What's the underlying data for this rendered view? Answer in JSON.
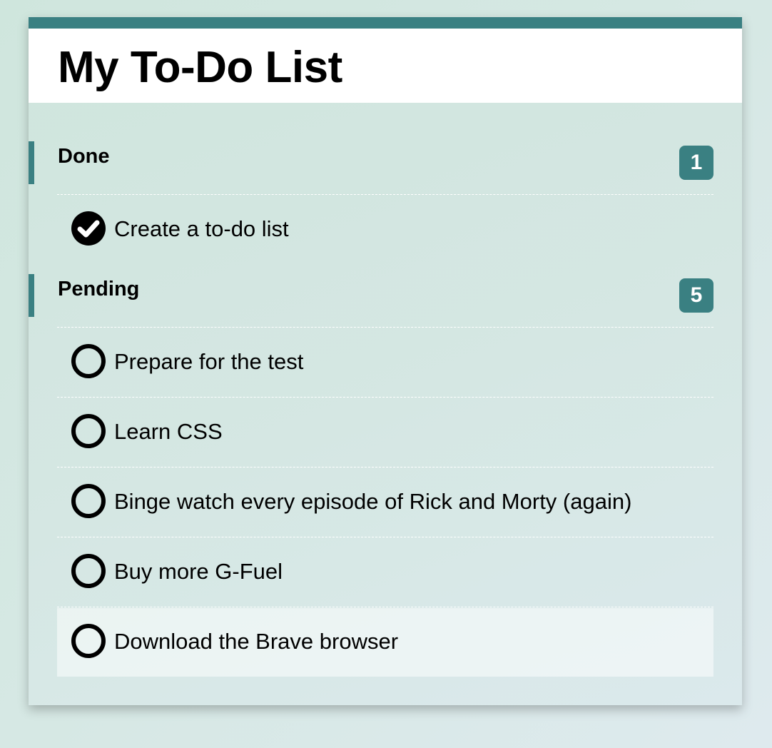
{
  "page": {
    "title": "My To-Do List"
  },
  "sections": {
    "done": {
      "label": "Done",
      "count": "1",
      "items": [
        {
          "label": "Create a to-do list",
          "checked": true
        }
      ]
    },
    "pending": {
      "label": "Pending",
      "count": "5",
      "items": [
        {
          "label": "Prepare for the test",
          "checked": false
        },
        {
          "label": "Learn CSS",
          "checked": false
        },
        {
          "label": "Binge watch every episode of Rick and Morty (again)",
          "checked": false
        },
        {
          "label": "Buy more G-Fuel",
          "checked": false
        },
        {
          "label": "Download the Brave browser",
          "checked": false
        }
      ]
    }
  },
  "icons": {
    "checked": "check-circle-icon",
    "unchecked": "empty-circle-icon"
  },
  "colors": {
    "accent": "#3a8082",
    "badge_text": "#ffffff",
    "header_bg": "#ffffff"
  }
}
